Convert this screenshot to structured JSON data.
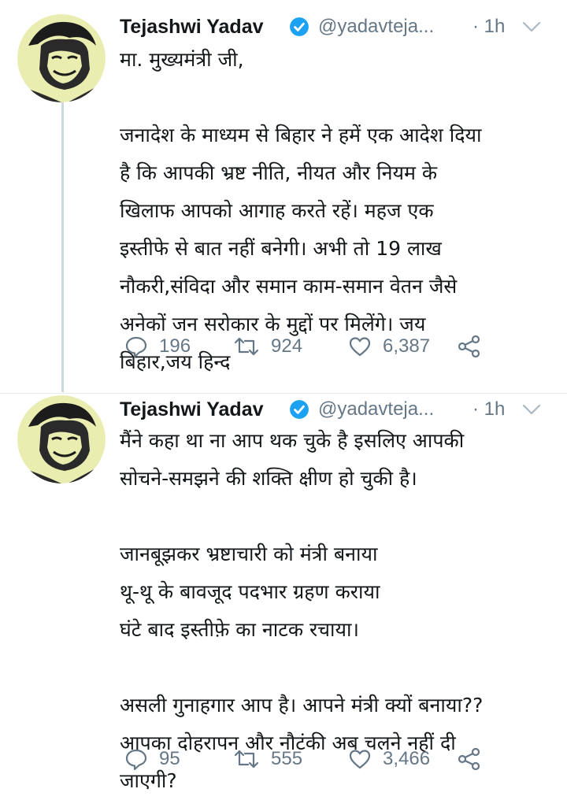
{
  "tweets": [
    {
      "author": {
        "name": "Tejashwi Yadav",
        "handle": "@yadavteja...",
        "time": "· 1h",
        "avatar_icon": "profile-photo"
      },
      "lines": [
        "मा. मुख्यमंत्री जी,",
        "",
        "जनादेश के माध्यम से बिहार ने हमें एक आदेश दिया",
        "है कि आपकी भ्रष्ट नीति, नीयत और नियम के",
        "खिलाफ आपको आगाह करते रहें। महज एक",
        "इस्तीफे से बात नहीं बनेगी। अभी तो 19 लाख",
        "नौकरी,संविदा और समान काम-समान वेतन जैसे",
        "अनेकों जन सरोकार के मुद्दों पर मिलेंगे। जय",
        "बिहार,जय हिन्द"
      ],
      "stats": {
        "replies": "196",
        "retweets": "924",
        "likes": "6,387"
      }
    },
    {
      "author": {
        "name": "Tejashwi Yadav",
        "handle": "@yadavteja...",
        "time": "· 1h",
        "avatar_icon": "profile-photo"
      },
      "lines": [
        "मैंने कहा था ना आप थक चुके है इसलिए आपकी",
        "सोचने-समझने की शक्ति क्षीण हो चुकी है।",
        "",
        "जानबूझकर भ्रष्टाचारी को मंत्री बनाया",
        "थू-थू के बावजूद पदभार ग्रहण कराया",
        "घंटे बाद इस्तीफ़े का नाटक रचाया।",
        "",
        "असली गुनाहगार आप है। आपने मंत्री क्यों बनाया??",
        "आपका दोहरापन और नौटंकी अब चलने नहीं दी",
        "जाएगी?"
      ],
      "stats": {
        "replies": "95",
        "retweets": "555",
        "likes": "3,466"
      }
    }
  ],
  "colors": {
    "verified": "#1da1f2",
    "muted": "#657786",
    "thread_line": "#ccd6dd",
    "avatar_bg": "#e9edb0"
  }
}
